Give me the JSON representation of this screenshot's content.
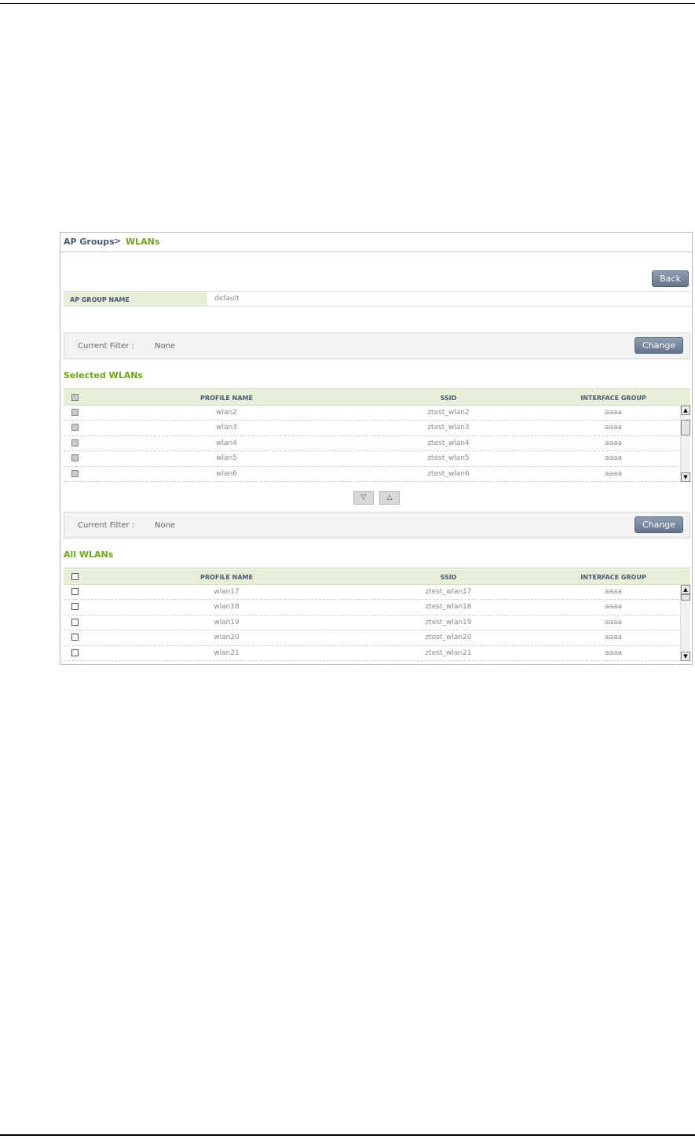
{
  "breadcrumb": {
    "root": "AP Groups",
    "separator": ">",
    "current": "WLANs"
  },
  "back_label": "Back",
  "ap_group": {
    "label": "AP GROUP NAME",
    "value": "default"
  },
  "selected_filter": {
    "label": "Current Filter :",
    "value": "None",
    "change_label": "Change"
  },
  "selected_wlans": {
    "title": "Selected WLANs",
    "columns": [
      "PROFILE NAME",
      "SSID",
      "INTERFACE GROUP"
    ],
    "rows": [
      {
        "profile": "wlan2",
        "ssid": "ztest_wlan2",
        "iface": "aaaa"
      },
      {
        "profile": "wlan3",
        "ssid": "ztest_wlan3",
        "iface": "aaaa"
      },
      {
        "profile": "wlan4",
        "ssid": "ztest_wlan4",
        "iface": "aaaa"
      },
      {
        "profile": "wlan5",
        "ssid": "ztest_wlan5",
        "iface": "aaaa"
      },
      {
        "profile": "wlan6",
        "ssid": "ztest_wlan6",
        "iface": "aaaa"
      }
    ],
    "scroll_up_icon": "triangle-up",
    "scroll_down_icon": "triangle-down"
  },
  "move_buttons": {
    "down_glyph": "▽",
    "up_glyph": "△"
  },
  "all_filter": {
    "label": "Current Filter :",
    "value": "None",
    "change_label": "Change"
  },
  "all_wlans": {
    "title": "All WLANs",
    "columns": [
      "PROFILE NAME",
      "SSID",
      "INTERFACE GROUP"
    ],
    "rows": [
      {
        "profile": "wlan17",
        "ssid": "ztest_wlan17",
        "iface": "aaaa"
      },
      {
        "profile": "wlan18",
        "ssid": "ztest_wlan18",
        "iface": "aaaa"
      },
      {
        "profile": "wlan19",
        "ssid": "ztest_wlan19",
        "iface": "aaaa"
      },
      {
        "profile": "wlan20",
        "ssid": "ztest_wlan20",
        "iface": "aaaa"
      },
      {
        "profile": "wlan21",
        "ssid": "ztest_wlan21",
        "iface": "aaaa"
      }
    ]
  },
  "colors": {
    "accent_green": "#6fa31c",
    "header_bg": "#e7efd9",
    "button": "#7a88a0"
  }
}
